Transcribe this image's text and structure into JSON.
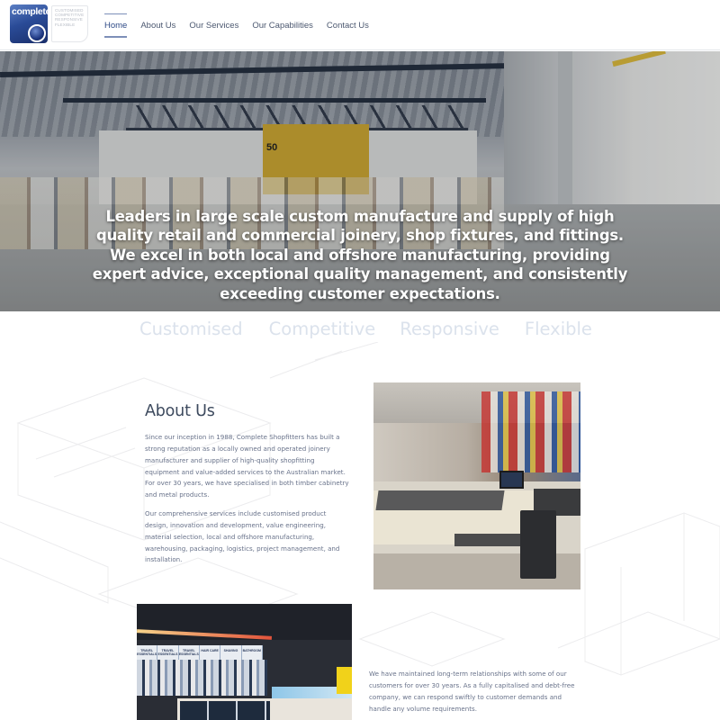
{
  "header": {
    "logo": {
      "wordmark": "complete",
      "taglines": [
        "CUSTOMISED",
        "COMPETITIVE",
        "RESPONSIVE",
        "FLEXIBLE"
      ]
    },
    "nav": [
      {
        "label": "Home",
        "active": true
      },
      {
        "label": "About Us",
        "active": false
      },
      {
        "label": "Our Services",
        "active": false
      },
      {
        "label": "Our Capabilities",
        "active": false
      },
      {
        "label": "Contact Us",
        "active": false
      }
    ]
  },
  "hero": {
    "image_alt": "warehouse-manufacturing-floor",
    "sign_text": "50",
    "headline": "Leaders in large scale custom manufacture and supply of high quality retail and commercial joinery, shop fixtures, and fittings. We excel in both local and offshore manufacturing, providing expert advice, exceptional quality management, and consistently exceeding customer expectations."
  },
  "values": [
    "Customised",
    "Competitive",
    "Responsive",
    "Flexible"
  ],
  "about": {
    "title": "About Us",
    "paragraphs": [
      "Since our inception in 1988, Complete Shopfitters has built a strong reputation as a locally owned and operated joinery manufacturer and supplier of high-quality shopfitting equipment and value-added services to the Australian market. For over 30 years, we have specialised in both timber cabinetry and metal products.",
      "Our comprehensive services include customised product design, innovation and development, value engineering, material selection, local and offshore manufacturing, warehousing, packaging, logistics, project management, and installation."
    ],
    "image_alt": "supermarket-self-checkout"
  },
  "relationships": {
    "image_alt": "retail-store-interior",
    "store_banners": [
      "TRAVEL ESSENTIALS",
      "TRAVEL ESSENTIALS",
      "TRAVEL ESSENTIALS",
      "HAIR CARE",
      "SHAVING",
      "BATHROOM"
    ],
    "paragraph": "We have maintained long-term relationships with some of our customers for over 30 years. As a fully capitalised and debt-free company, we can respond swiftly to customer demands and handle any volume requirements."
  },
  "colors": {
    "brand_blue": "#2a4b97",
    "nav_active": "#2f4b87",
    "values_text": "#dbe2ec",
    "body_text": "#68728a",
    "heading_text": "#3d4a5e"
  }
}
